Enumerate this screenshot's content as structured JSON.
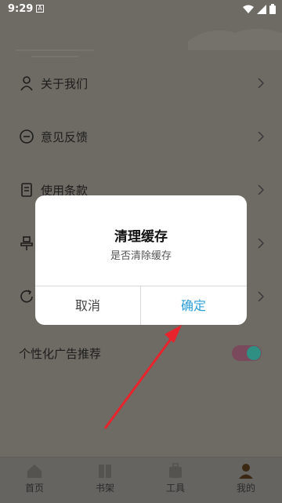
{
  "status_bar": {
    "time": "9:29",
    "notif_glyph": "A",
    "icons": [
      "wifi-icon",
      "signal-icon",
      "battery-icon"
    ]
  },
  "menu": {
    "items": [
      {
        "label": "关于我们",
        "icon": "person-icon"
      },
      {
        "label": "意见反馈",
        "icon": "chat-icon"
      },
      {
        "label": "使用条款",
        "icon": "document-icon"
      },
      {
        "label": "",
        "icon": "stamp-icon"
      },
      {
        "label": "",
        "icon": "refresh-icon"
      }
    ],
    "ad_toggle": {
      "label": "个性化广告推荐",
      "on": true
    }
  },
  "dialog": {
    "title": "清理缓存",
    "message": "是否清除缓存",
    "cancel_label": "取消",
    "confirm_label": "确定"
  },
  "bottom_nav": {
    "items": [
      {
        "label": "首页",
        "icon": "home-icon"
      },
      {
        "label": "书架",
        "icon": "bookshelf-icon"
      },
      {
        "label": "工具",
        "icon": "toolbox-icon"
      },
      {
        "label": "我的",
        "icon": "user-icon",
        "active": true
      }
    ]
  },
  "colors": {
    "overlay": "#6e6b64",
    "confirm_blue": "#2b9fd8",
    "arrow_red": "#e8232b",
    "toggle_track": "#7a4a5c",
    "toggle_knob": "#2e8f82"
  }
}
